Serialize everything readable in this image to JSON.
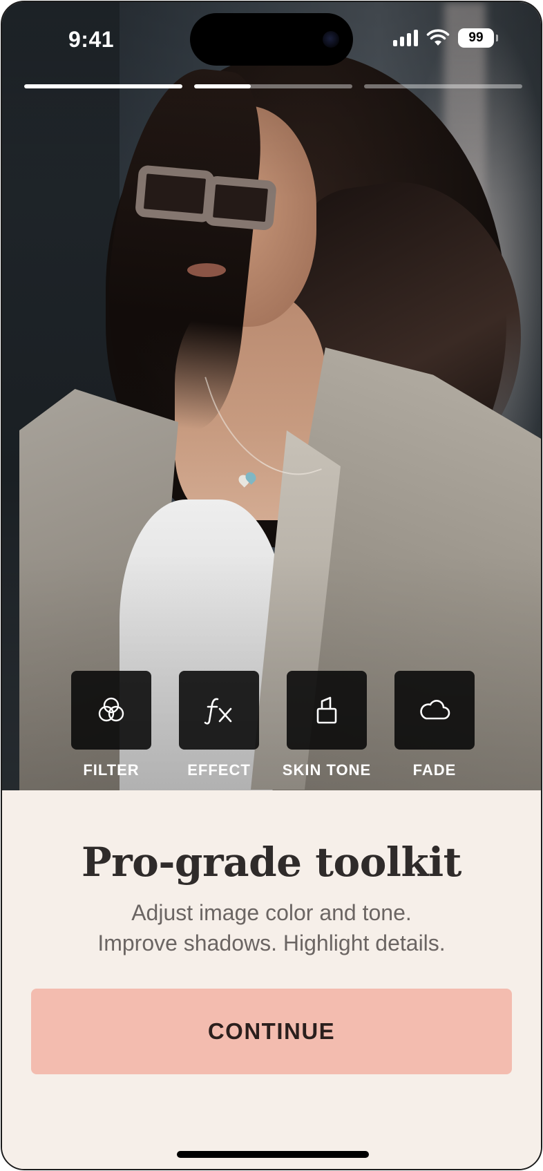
{
  "status_bar": {
    "time": "9:41",
    "battery": "99",
    "icons": [
      "cellular-signal-icon",
      "wifi-icon",
      "battery-icon"
    ]
  },
  "story_progress": {
    "segments": [
      1.0,
      0.36,
      0.0
    ]
  },
  "tools": [
    {
      "label": "FILTER",
      "icon": "filter-circles-icon"
    },
    {
      "label": "EFFECT",
      "icon": "fx-icon"
    },
    {
      "label": "SKIN TONE",
      "icon": "lipstick-icon"
    },
    {
      "label": "FADE",
      "icon": "cloud-icon"
    }
  ],
  "onboarding": {
    "title": "Pro-grade toolkit",
    "subtitle_line1": "Adjust image color and tone.",
    "subtitle_line2": "Improve shadows. Highlight details.",
    "continue_label": "CONTINUE"
  },
  "colors": {
    "sheet_background": "#f6efe9",
    "button": "#f3bcaf",
    "title_text": "#2f2b2a",
    "subtitle_text": "#6b6563"
  }
}
